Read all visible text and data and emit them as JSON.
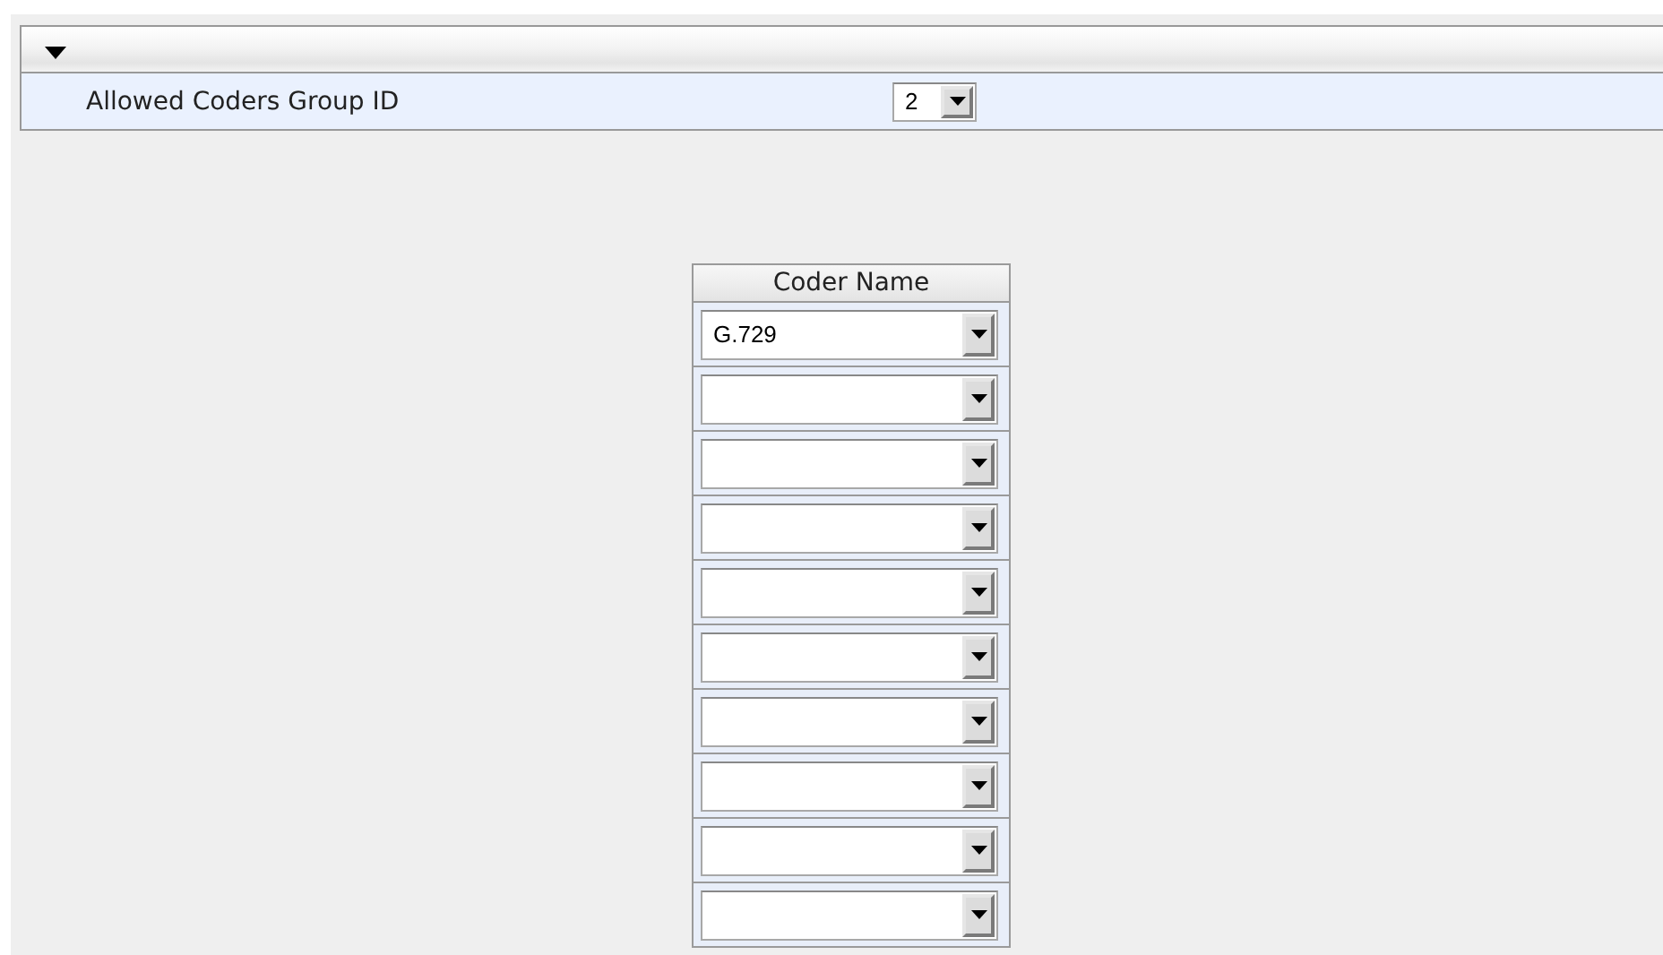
{
  "section": {
    "expanded": true,
    "fields": [
      {
        "label": "Allowed Coders Group ID",
        "value": "2"
      }
    ]
  },
  "coder_table": {
    "columns": [
      "Coder Name"
    ],
    "rows": [
      {
        "kind": "dropdown",
        "value": "G.729"
      },
      {
        "kind": "dropdown"
      },
      {
        "kind": "dropdown"
      },
      {
        "kind": "dropdown"
      },
      {
        "kind": "dropdown"
      },
      {
        "kind": "dropdown"
      },
      {
        "kind": "dropdown"
      },
      {
        "kind": "dropdown"
      },
      {
        "kind": "dropdown"
      },
      {
        "kind": "dropdown"
      }
    ]
  }
}
